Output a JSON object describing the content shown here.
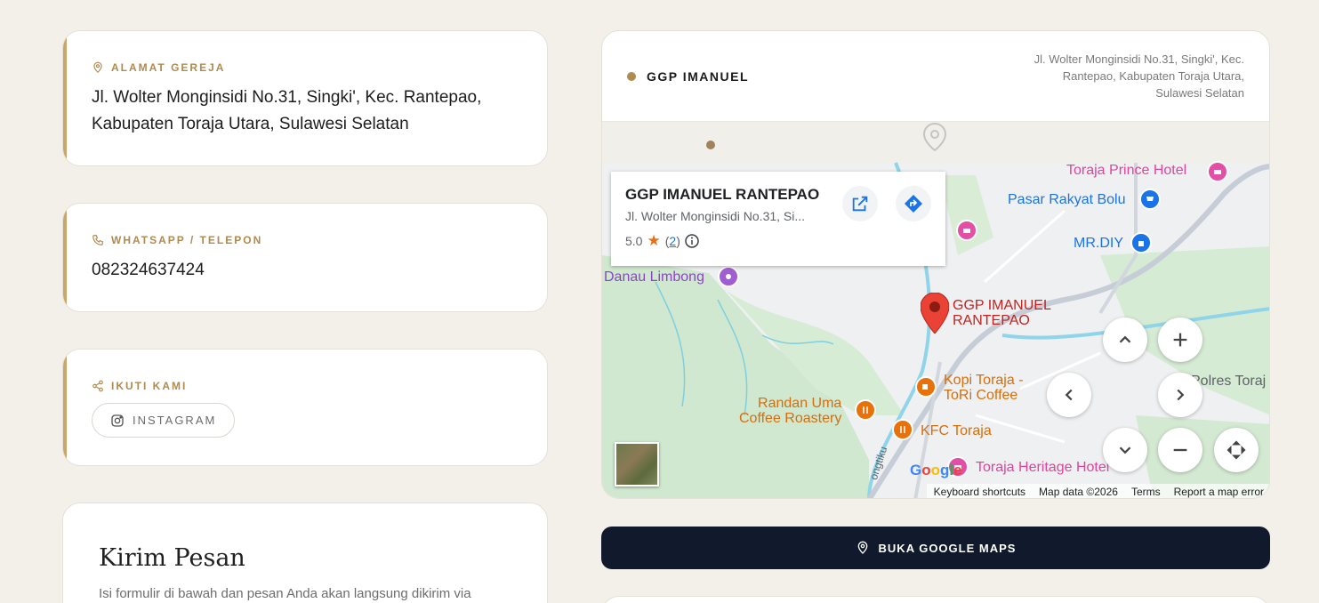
{
  "address_card": {
    "label": "ALAMAT GEREJA",
    "icon": "location-pin-icon",
    "value_line1": "Jl. Wolter Monginsidi No.31, Singki', Kec. Rantepao,",
    "value_line2": "Kabupaten Toraja Utara, Sulawesi Selatan"
  },
  "phone_card": {
    "label": "WHATSAPP / TELEPON",
    "icon": "phone-icon",
    "value": "082324637424"
  },
  "social_card": {
    "label": "IKUTI KAMI",
    "icon": "share-icon",
    "instagram_label": "INSTAGRAM"
  },
  "form_card": {
    "title": "Kirim Pesan",
    "description": "Isi formulir di bawah dan pesan Anda akan langsung dikirim via"
  },
  "map_card": {
    "title": "GGP IMANUEL",
    "address_line1": "Jl. Wolter Monginsidi No.31, Singki', Kec.",
    "address_line2": "Rantepao, Kabupaten Toraja Utara,",
    "address_line3": "Sulawesi Selatan",
    "infobox": {
      "name": "GGP IMANUEL RANTEPAO",
      "address": "Jl. Wolter Monginsidi No.31, Si...",
      "rating": "5.0",
      "reviews": "2",
      "rev_open": "(",
      "rev_close": ")"
    },
    "marker_label_line1": "GGP IMANUEL",
    "marker_label_line2": "RANTEPAO",
    "poi": {
      "prince_hotel": "Toraja Prince Hotel",
      "pasar": "Pasar Rakyat Bolu",
      "mrdiy": "MR.DIY",
      "danau": "Danau Limbong",
      "kopi1": "Kopi Toraja -",
      "kopi2": "ToRi Coffee",
      "randan1": "Randan Uma",
      "randan2": "Coffee Roastery",
      "kfc": "KFC Toraja",
      "heritage": "Toraja Heritage Hotel",
      "polres": "Polres Toraj",
      "road": "ongtiku"
    },
    "google": "Google",
    "attribution": {
      "shortcuts": "Keyboard shortcuts",
      "data": "Map data ©2026",
      "terms": "Terms",
      "report": "Report a map error"
    }
  },
  "maps_button": {
    "label": "BUKA GOOGLE MAPS"
  },
  "colors": {
    "accent": "#c9a66b",
    "button_bg": "#111a2c",
    "page_bg": "#f3f0ea"
  }
}
